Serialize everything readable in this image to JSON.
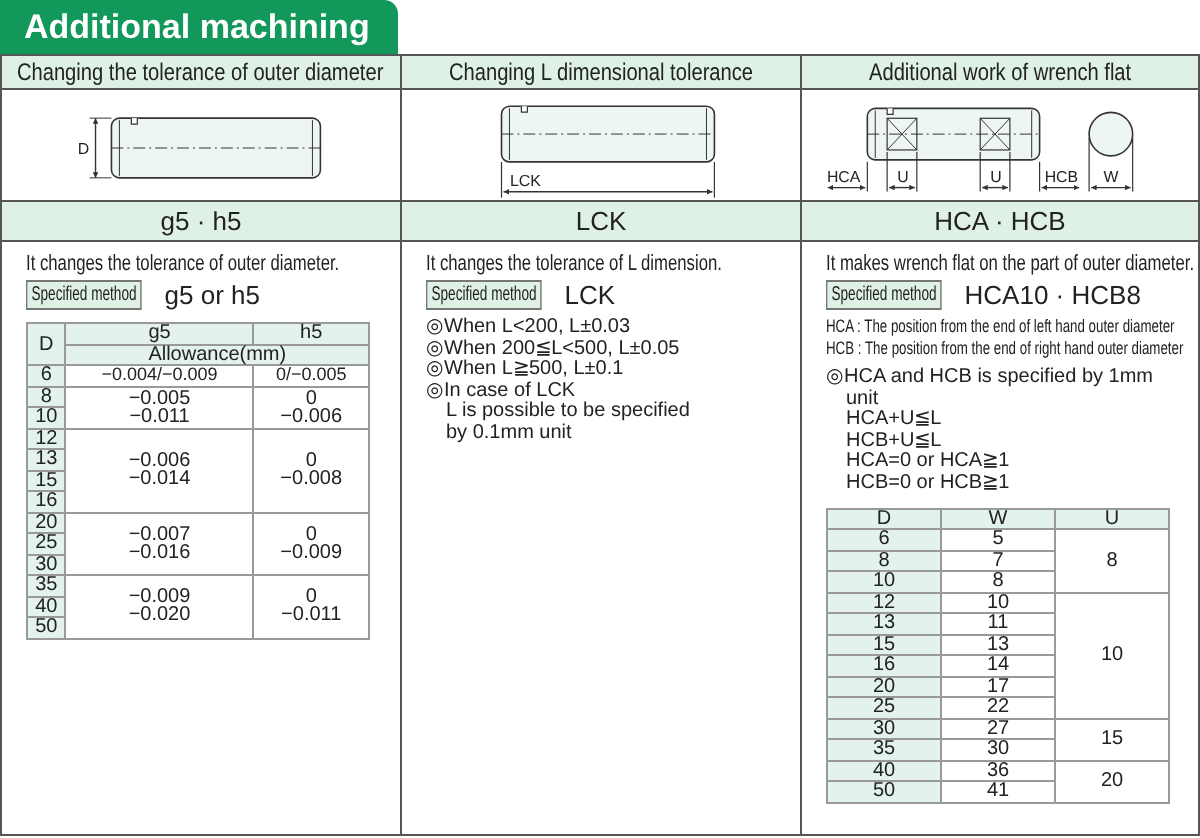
{
  "title": "Additional machining",
  "sections": [
    {
      "heading": "Changing the tolerance of outer diameter",
      "drawing": {
        "kind": "diameter",
        "labels": [
          "D"
        ]
      },
      "code": "g5 · h5",
      "description": "It changes the tolerance of outer diameter.",
      "method_label": "Specified method",
      "method_value": "g5 or h5",
      "table": {
        "kind": "allowance",
        "header": [
          "D",
          "g5",
          "h5"
        ],
        "subheader": "Allowance(mm)",
        "groups": [
          {
            "d": [
              "6"
            ],
            "g5": [
              "−0.004/−0.009"
            ],
            "h5": [
              "0/−0.005"
            ]
          },
          {
            "d": [
              "8",
              "10"
            ],
            "g5": [
              "−0.005",
              "−0.011"
            ],
            "h5": [
              "0",
              "−0.006"
            ]
          },
          {
            "d": [
              "12",
              "13",
              "15",
              "16"
            ],
            "g5": [
              "−0.006",
              "−0.014"
            ],
            "h5": [
              "0",
              "−0.008"
            ]
          },
          {
            "d": [
              "20",
              "25",
              "30"
            ],
            "g5": [
              "−0.007",
              "−0.016"
            ],
            "h5": [
              "0",
              "−0.009"
            ]
          },
          {
            "d": [
              "35",
              "40",
              "50"
            ],
            "g5": [
              "−0.009",
              "−0.020"
            ],
            "h5": [
              "0",
              "−0.011"
            ]
          }
        ]
      }
    },
    {
      "heading": "Changing L dimensional tolerance",
      "drawing": {
        "kind": "length",
        "labels": [
          "LCK"
        ]
      },
      "code": "LCK",
      "description": "It changes the tolerance of L dimension.",
      "method_label": "Specified method",
      "method_value": "LCK",
      "notes": [
        "◎When L<200, L±0.03",
        "◎When 200≦L<500, L±0.05",
        "◎When L≧500, L±0.1",
        "◎In case of LCK\nL is possible to be specified\nby 0.1mm unit"
      ]
    },
    {
      "heading": "Additional work of wrench flat",
      "drawing": {
        "kind": "wrench",
        "labels": [
          "HCA",
          "U",
          "U",
          "HCB",
          "W"
        ]
      },
      "code": "HCA · HCB",
      "description": "It makes wrench flat on the part of outer diameter.",
      "method_label": "Specified method",
      "method_value": "HCA10 · HCB8",
      "definitions": [
        "HCA : The position from the end of left hand outer diameter",
        "HCB : The position from the end of right hand outer diameter"
      ],
      "notes": [
        "◎HCA and HCB is specified by 1mm unit\nHCA+U≦L\nHCB+U≦L\nHCA=0 or HCA≧1\nHCB=0 or HCB≧1"
      ],
      "table": {
        "kind": "wrench",
        "header": [
          "D",
          "W",
          "U"
        ],
        "groups": [
          {
            "u": "8",
            "rows": [
              [
                "6",
                "5"
              ],
              [
                "8",
                "7"
              ],
              [
                "10",
                "8"
              ]
            ]
          },
          {
            "u": "10",
            "rows": [
              [
                "12",
                "10"
              ],
              [
                "13",
                "11"
              ],
              [
                "15",
                "13"
              ],
              [
                "16",
                "14"
              ],
              [
                "20",
                "17"
              ],
              [
                "25",
                "22"
              ]
            ]
          },
          {
            "u": "15",
            "rows": [
              [
                "30",
                "27"
              ],
              [
                "35",
                "30"
              ]
            ]
          },
          {
            "u": "20",
            "rows": [
              [
                "40",
                "36"
              ],
              [
                "50",
                "41"
              ]
            ]
          }
        ]
      }
    }
  ]
}
